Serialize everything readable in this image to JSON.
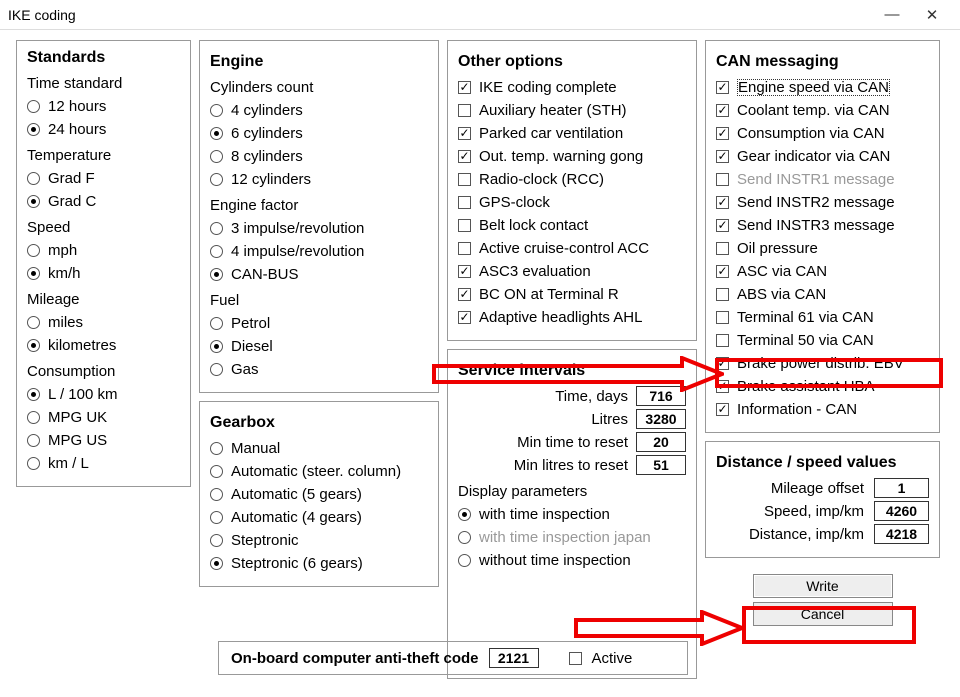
{
  "window": {
    "title": "IKE coding",
    "minimize": "—",
    "close": "✕"
  },
  "standards": {
    "title": "Standards",
    "time_label": "Time standard",
    "time": [
      {
        "label": "12 hours",
        "checked": false
      },
      {
        "label": "24 hours",
        "checked": true
      }
    ],
    "temp_label": "Temperature",
    "temp": [
      {
        "label": "Grad F",
        "checked": false
      },
      {
        "label": "Grad C",
        "checked": true
      }
    ],
    "speed_label": "Speed",
    "speed": [
      {
        "label": "mph",
        "checked": false
      },
      {
        "label": "km/h",
        "checked": true
      }
    ],
    "mileage_label": "Mileage",
    "mileage": [
      {
        "label": "miles",
        "checked": false
      },
      {
        "label": "kilometres",
        "checked": true
      }
    ],
    "cons_label": "Consumption",
    "cons": [
      {
        "label": "L / 100 km",
        "checked": true
      },
      {
        "label": "MPG UK",
        "checked": false
      },
      {
        "label": "MPG US",
        "checked": false
      },
      {
        "label": "km / L",
        "checked": false
      }
    ]
  },
  "engine": {
    "title": "Engine",
    "cyl_label": "Cylinders count",
    "cyl": [
      {
        "label": "4 cylinders",
        "checked": false
      },
      {
        "label": "6 cylinders",
        "checked": true
      },
      {
        "label": "8 cylinders",
        "checked": false
      },
      {
        "label": "12 cylinders",
        "checked": false
      }
    ],
    "factor_label": "Engine factor",
    "factor": [
      {
        "label": "3 impulse/revolution",
        "checked": false
      },
      {
        "label": "4 impulse/revolution",
        "checked": false
      },
      {
        "label": "CAN-BUS",
        "checked": true
      }
    ],
    "fuel_label": "Fuel",
    "fuel": [
      {
        "label": "Petrol",
        "checked": false
      },
      {
        "label": "Diesel",
        "checked": true
      },
      {
        "label": "Gas",
        "checked": false
      }
    ]
  },
  "gearbox": {
    "title": "Gearbox",
    "opts": [
      {
        "label": "Manual",
        "checked": false
      },
      {
        "label": "Automatic (steer. column)",
        "checked": false
      },
      {
        "label": "Automatic (5 gears)",
        "checked": false
      },
      {
        "label": "Automatic (4 gears)",
        "checked": false
      },
      {
        "label": "Steptronic",
        "checked": false
      },
      {
        "label": "Steptronic (6 gears)",
        "checked": true
      }
    ]
  },
  "other": {
    "title": "Other options",
    "opts": [
      {
        "label": "IKE coding complete",
        "checked": true
      },
      {
        "label": "Auxiliary heater (STH)",
        "checked": false
      },
      {
        "label": "Parked car ventilation",
        "checked": true
      },
      {
        "label": "Out. temp. warning gong",
        "checked": true
      },
      {
        "label": "Radio-clock (RCC)",
        "checked": false
      },
      {
        "label": "GPS-clock",
        "checked": false
      },
      {
        "label": "Belt lock contact",
        "checked": false
      },
      {
        "label": "Active cruise-control ACC",
        "checked": false
      },
      {
        "label": "ASC3 evaluation",
        "checked": true
      },
      {
        "label": "BC ON at Terminal R",
        "checked": true
      },
      {
        "label": "Adaptive headlights AHL",
        "checked": true
      }
    ]
  },
  "service": {
    "title": "Service intervals",
    "rows": [
      {
        "label": "Time, days",
        "value": "716"
      },
      {
        "label": "Litres",
        "value": "3280"
      },
      {
        "label": "Min time to reset",
        "value": "20"
      },
      {
        "label": "Min litres to reset",
        "value": "51"
      }
    ],
    "display_label": "Display parameters",
    "display": [
      {
        "label": "with time inspection",
        "checked": true,
        "disabled": false
      },
      {
        "label": "with time inspection japan",
        "checked": false,
        "disabled": true
      },
      {
        "label": "without time inspection",
        "checked": false,
        "disabled": false
      }
    ]
  },
  "can": {
    "title": "CAN messaging",
    "opts": [
      {
        "label": "Engine speed via CAN",
        "checked": true,
        "dotted": true
      },
      {
        "label": "Coolant temp. via CAN",
        "checked": true
      },
      {
        "label": "Consumption via CAN",
        "checked": true
      },
      {
        "label": "Gear indicator via CAN",
        "checked": true
      },
      {
        "label": "Send INSTR1 message",
        "checked": false,
        "disabled": true
      },
      {
        "label": "Send INSTR2 message",
        "checked": true
      },
      {
        "label": "Send INSTR3 message",
        "checked": true
      },
      {
        "label": "Oil pressure",
        "checked": false
      },
      {
        "label": "ASC via CAN",
        "checked": true
      },
      {
        "label": "ABS via CAN",
        "checked": false
      },
      {
        "label": "Terminal 61 via CAN",
        "checked": false
      },
      {
        "label": "Terminal 50 via CAN",
        "checked": false
      },
      {
        "label": "Brake power distrib. EBV",
        "checked": true
      },
      {
        "label": "Brake assistant HBA",
        "checked": true
      },
      {
        "label": "Information - CAN",
        "checked": true
      }
    ]
  },
  "dist": {
    "title": "Distance / speed values",
    "rows": [
      {
        "label": "Mileage offset",
        "value": "1"
      },
      {
        "label": "Speed, imp/km",
        "value": "4260"
      },
      {
        "label": "Distance, imp/km",
        "value": "4218"
      }
    ]
  },
  "obc": {
    "label": "On-board computer anti-theft code",
    "code": "2121",
    "active_label": "Active",
    "active": false
  },
  "buttons": {
    "write": "Write",
    "cancel": "Cancel"
  }
}
